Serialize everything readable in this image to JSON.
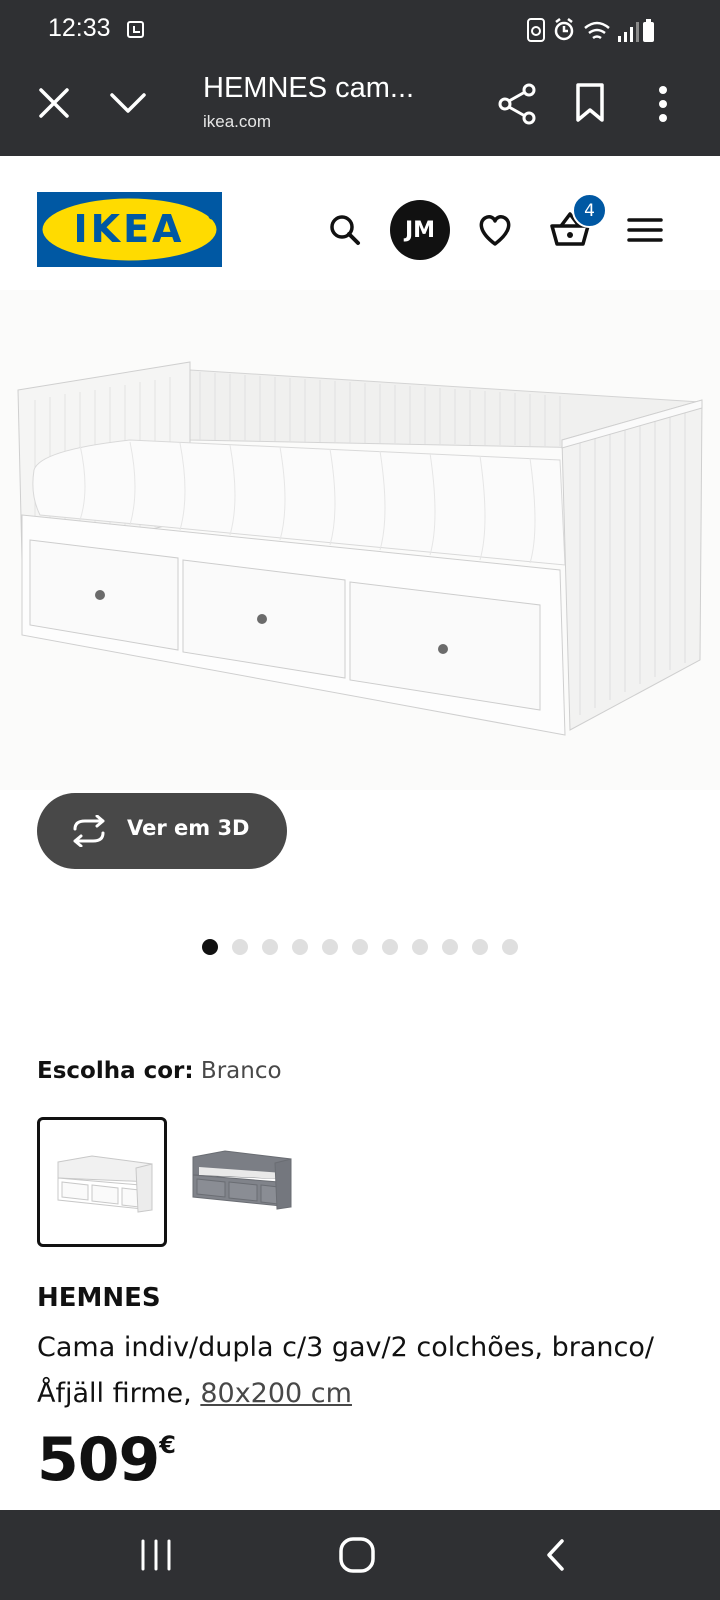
{
  "status_bar": {
    "time": "12:33"
  },
  "browser": {
    "title": "HEMNES cam...",
    "url": "ikea.com"
  },
  "header": {
    "logo_text": "IKEA",
    "avatar_initials": "JM",
    "cart_count": "4"
  },
  "gallery": {
    "view_3d_label": "Ver em 3D",
    "image_count": 11,
    "active_index": 0
  },
  "color_picker": {
    "label": "Escolha cor:",
    "selected_value": "Branco",
    "options": [
      "branco",
      "cinzento"
    ]
  },
  "product": {
    "name": "HEMNES",
    "description": "Cama indiv/dupla c/3 gav/2 colchões, branco/ Åfjäll firme,",
    "size_link": "80x200 cm",
    "price_integer": "509",
    "price_currency": "€"
  },
  "colors": {
    "system_bar": "#2f3033",
    "ikea_blue": "#0058a3",
    "ikea_yellow": "#ffdb00",
    "dark_pill": "#484848"
  }
}
